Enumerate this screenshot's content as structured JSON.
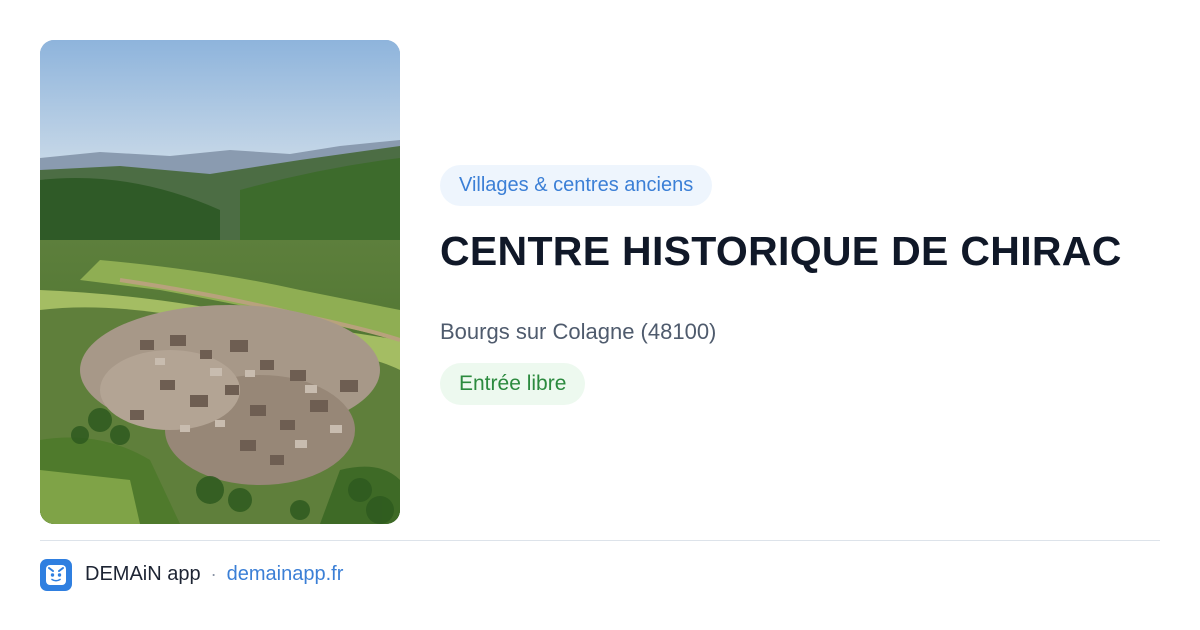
{
  "preview": {
    "image_alt": "Vue aérienne du village de Chirac",
    "category": "Villages & centres anciens",
    "title": "CENTRE HISTORIQUE DE CHIRAC",
    "location": "Bourgs sur Colagne (48100)",
    "access": "Entrée libre"
  },
  "footer": {
    "app_name": "DEMAiN app",
    "separator": "·",
    "domain": "demainapp.fr",
    "app_icon": "demain-app-icon"
  },
  "colors": {
    "accent_blue": "#3b7fd6",
    "category_bg": "#eef5fd",
    "access_green": "#2b8a3e",
    "access_bg": "#edf9ef",
    "title": "#101828"
  }
}
